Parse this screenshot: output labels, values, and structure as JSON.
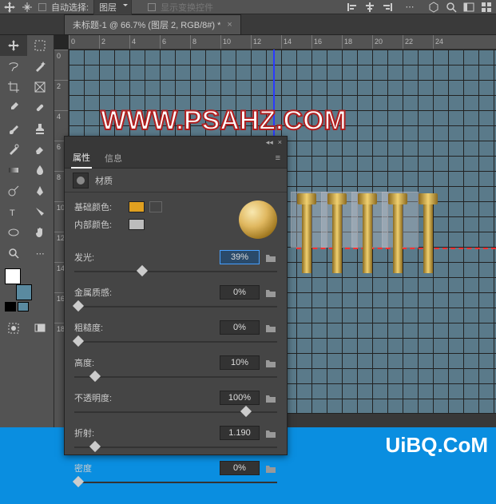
{
  "topbar": {
    "auto_select_label": "自动选择:",
    "dropdown_value": "图层",
    "show_controls_label": "显示变换控件"
  },
  "tab": {
    "title": "未标题-1 @ 66.7% (图层 2, RGB/8#) *"
  },
  "ruler_h": [
    "0",
    "2",
    "4",
    "6",
    "8",
    "10",
    "12",
    "14",
    "16",
    "18",
    "20",
    "22",
    "24"
  ],
  "ruler_v": [
    "0",
    "2",
    "4",
    "6",
    "8",
    "10",
    "12",
    "14",
    "16",
    "18"
  ],
  "watermark": "WWW.PSAHZ.COM",
  "watermark2": "UiBQ.CoM",
  "props": {
    "tab_properties": "属性",
    "tab_info": "信息",
    "subtitle": "材质",
    "base_color_label": "基础颜色:",
    "inner_color_label": "内部颜色:",
    "base_color": "#e0a020",
    "inner_color": "#bcbcbc",
    "sliders": [
      {
        "label": "发光:",
        "value": "39%",
        "pos": 38,
        "hl": true
      },
      {
        "label": "金属质感:",
        "value": "0%",
        "pos": 0
      },
      {
        "label": "粗糙度:",
        "value": "0%",
        "pos": 0
      },
      {
        "label": "高度:",
        "value": "10%",
        "pos": 10
      },
      {
        "label": "不透明度:",
        "value": "100%",
        "pos": 100
      },
      {
        "label": "折射:",
        "value": "1.190",
        "pos": 10
      },
      {
        "label": "密度",
        "value": "0%",
        "pos": 0
      }
    ]
  },
  "swatches": {
    "front": "#ffffff",
    "back": "#5a8aa0"
  }
}
